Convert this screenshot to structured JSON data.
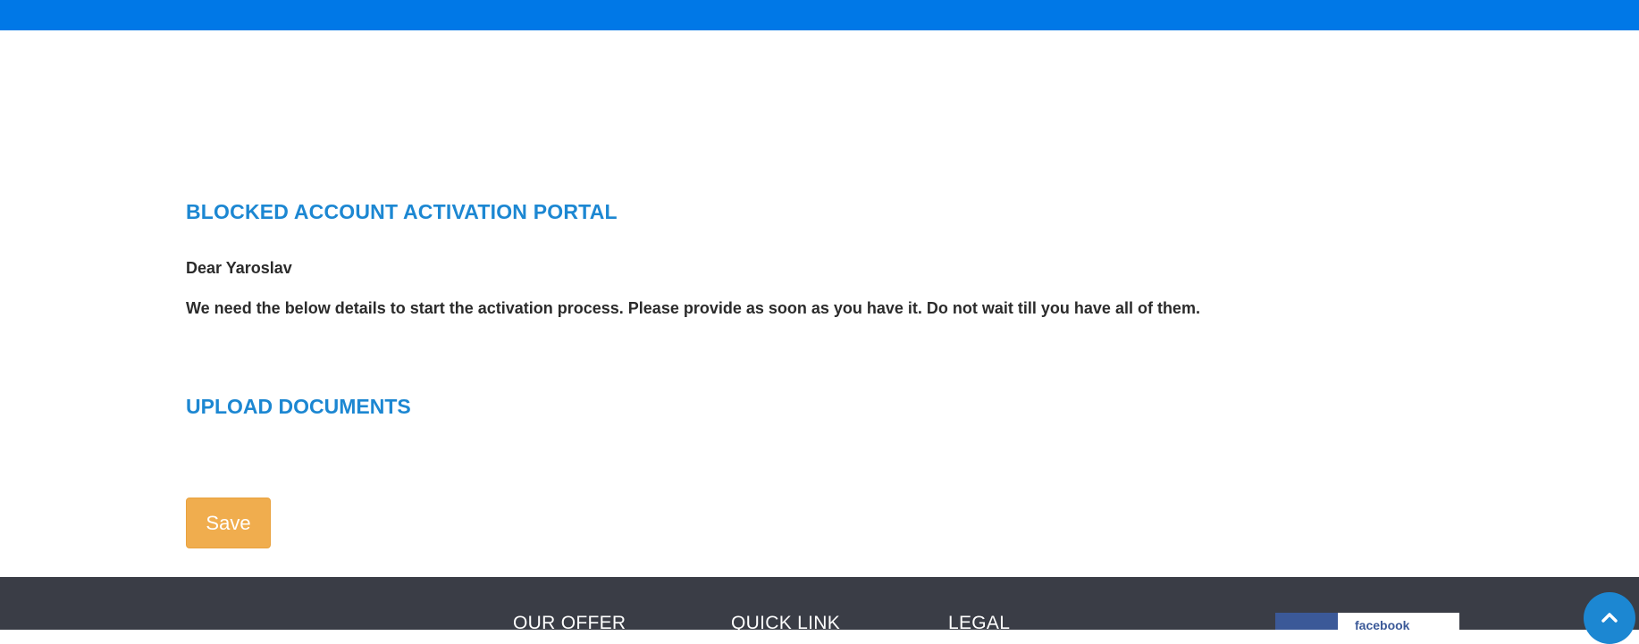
{
  "header": {
    "bar_color": "#0078e7"
  },
  "main": {
    "portal_title": "BLOCKED ACCOUNT ACTIVATION PORTAL",
    "greeting": "Dear Yaroslav",
    "instructions": "We need the below details to start the activation process. Please provide as soon as you have it. Do not wait till you have all of them.",
    "upload_title": "UPLOAD DOCUMENTS",
    "save_label": "Save"
  },
  "footer": {
    "headings": [
      "OUR OFFER",
      "QUICK LINK",
      "LEGAL"
    ],
    "facebook_label": "facebook"
  },
  "icons": {
    "scroll_top": "chevron-up-icon"
  },
  "colors": {
    "accent": "#1c87d2",
    "save_button": "#f0ad4e",
    "footer_bg": "#3a3d46",
    "facebook": "#3b5998"
  }
}
